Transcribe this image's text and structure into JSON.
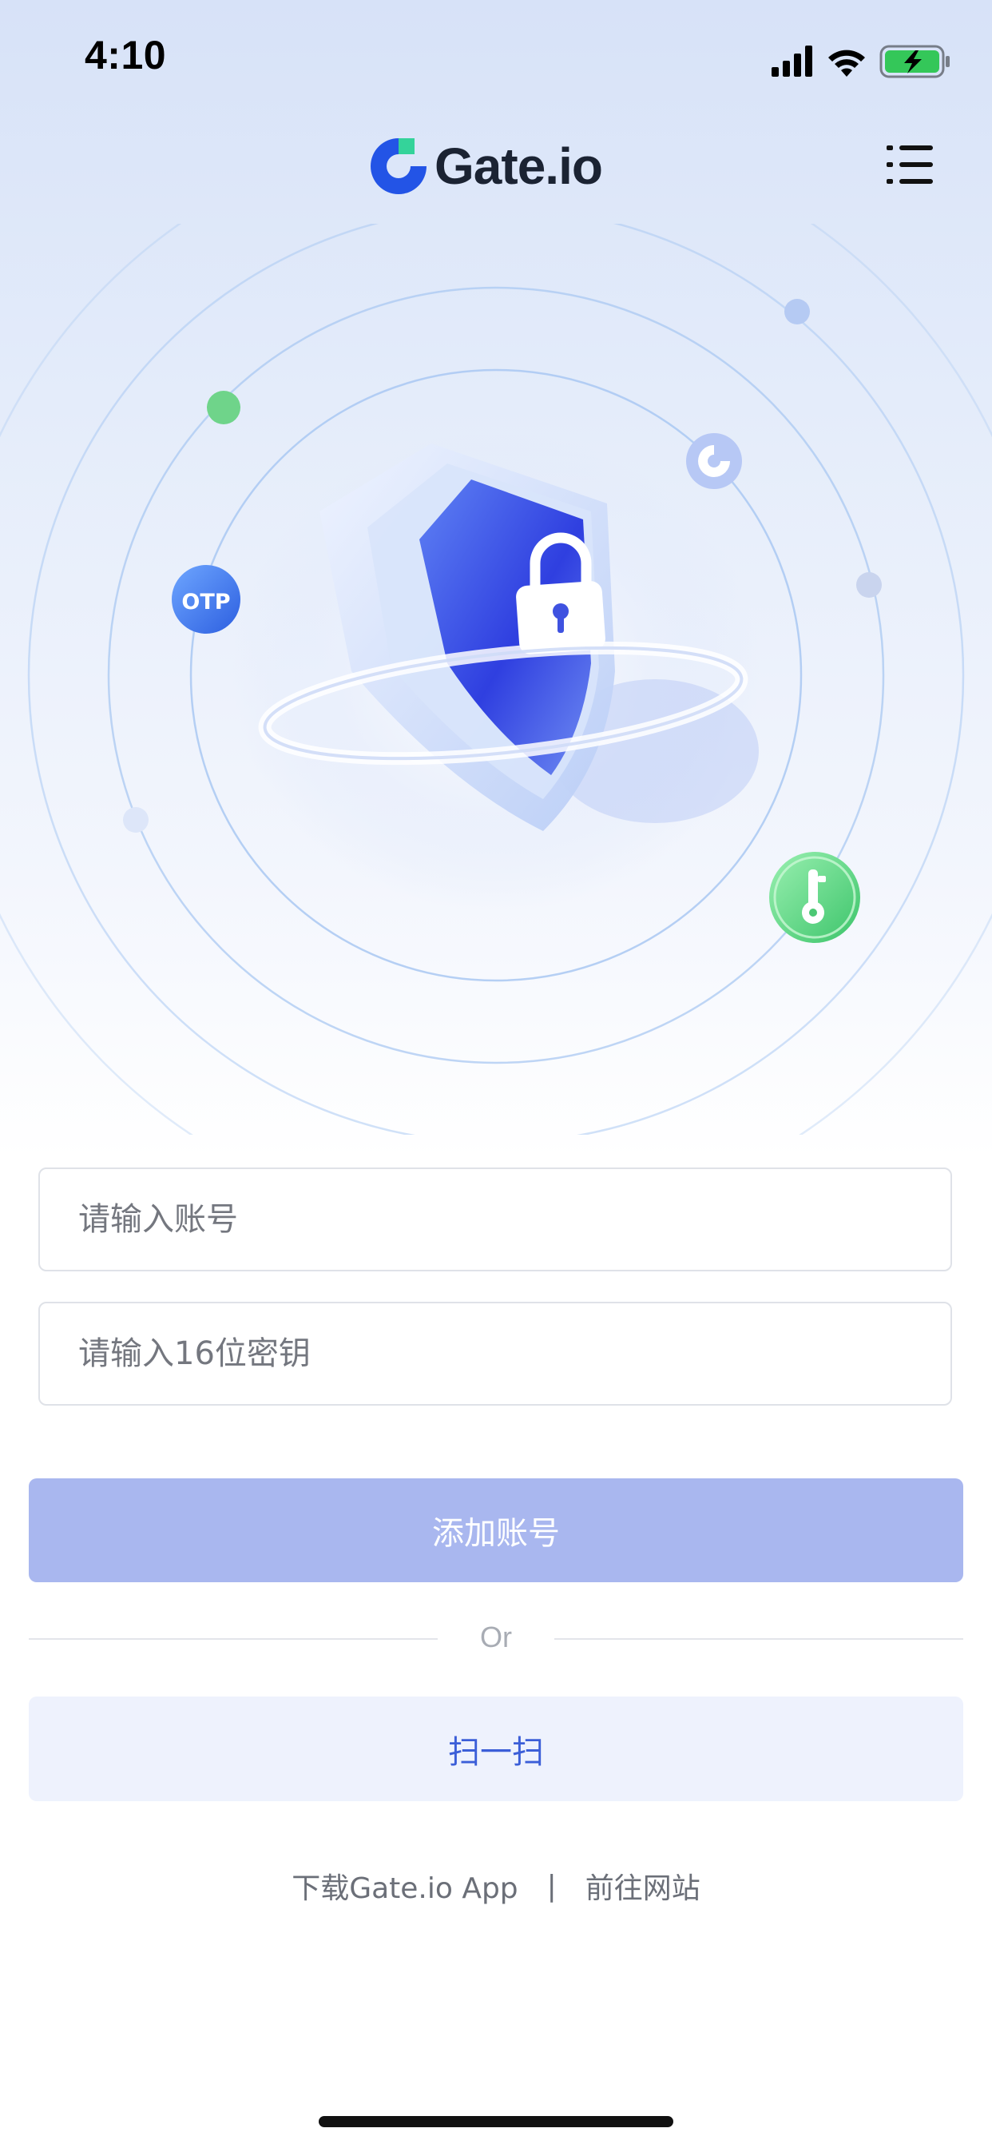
{
  "status_bar": {
    "time": "4:10"
  },
  "brand": {
    "name": "Gate.io",
    "accent": "#2354e6",
    "accent_green": "#34d39a"
  },
  "hero": {
    "otp_badge": "OTP"
  },
  "form": {
    "account_placeholder": "请输入账号",
    "secret_placeholder": "请输入16位密钥",
    "add_label": "添加账号",
    "or_label": "Or",
    "scan_label": "扫一扫"
  },
  "footer": {
    "download_label": "下载Gate.io App",
    "separator": "|",
    "website_label": "前往网站"
  },
  "colors": {
    "add_button": "#a9b7ef",
    "scan_button_bg": "#eef2fd",
    "scan_text": "#3b5ed8"
  }
}
